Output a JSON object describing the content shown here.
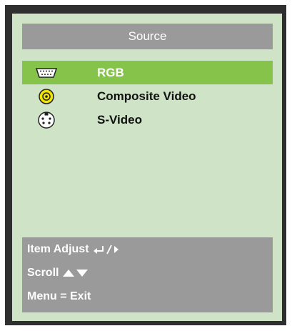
{
  "menu": {
    "title": "Source",
    "items": [
      {
        "label": "RGB",
        "icon": "vga-connector-icon",
        "selected": true
      },
      {
        "label": "Composite Video",
        "icon": "rca-connector-icon",
        "selected": false
      },
      {
        "label": "S-Video",
        "icon": "s-video-connector-icon",
        "selected": false
      }
    ]
  },
  "help": {
    "item_adjust": "Item Adjust",
    "scroll": "Scroll",
    "menu_exit": "Menu = Exit"
  },
  "colors": {
    "outer": "#2f2f2f",
    "panel": "#cfe3c7",
    "bar": "#9a9a9a",
    "selected": "#86c34a",
    "rca_yellow": "#f2e600"
  }
}
